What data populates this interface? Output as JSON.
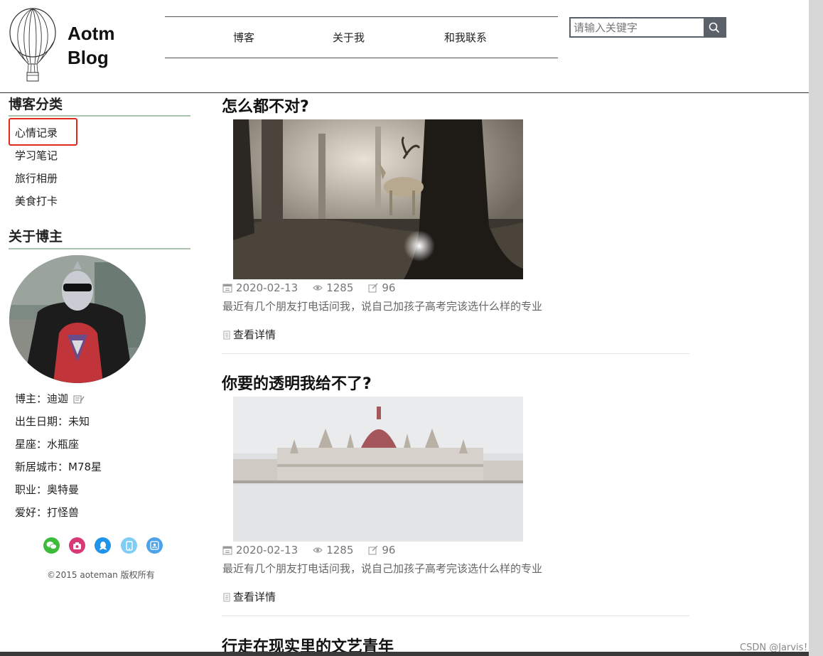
{
  "header": {
    "brand_line1": "Aotm",
    "brand_line2": "Blog",
    "nav": [
      "博客",
      "关于我",
      "和我联系"
    ],
    "search_placeholder": "请输入关键字"
  },
  "sidebar": {
    "categories_title": "博客分类",
    "categories": [
      "心情记录",
      "学习笔记",
      "旅行相册",
      "美食打卡"
    ],
    "about_title": "关于博主",
    "info": [
      "博主：迪迦",
      "出生日期：未知",
      "星座：水瓶座",
      "新居城市：M78星",
      "职业：奥特曼",
      "爱好：打怪兽"
    ],
    "social_icons": [
      "wechat-icon",
      "weibo-icon",
      "qq-icon",
      "phone-icon",
      "contact-icon"
    ],
    "social_colors": [
      "#3dbb3a",
      "#d83a78",
      "#2193e8",
      "#7fcdf4",
      "#4ea3e8"
    ],
    "copyright": "©2015 aoteman 版权所有"
  },
  "articles": [
    {
      "title": "怎么都不对?",
      "date": "2020-02-13",
      "views": "1285",
      "comments": "96",
      "summary": "最近有几个朋友打电话问我，说自己加孩子高考完该选什么样的专业",
      "more": "查看详情"
    },
    {
      "title": "你要的透明我给不了?",
      "date": "2020-02-13",
      "views": "1285",
      "comments": "96",
      "summary": "最近有几个朋友打电话问我，说自己加孩子高考完该选什么样的专业",
      "more": "查看详情"
    },
    {
      "title": "行走在现实里的文艺青年"
    }
  ],
  "watermark": "CSDN @Jarvis！"
}
